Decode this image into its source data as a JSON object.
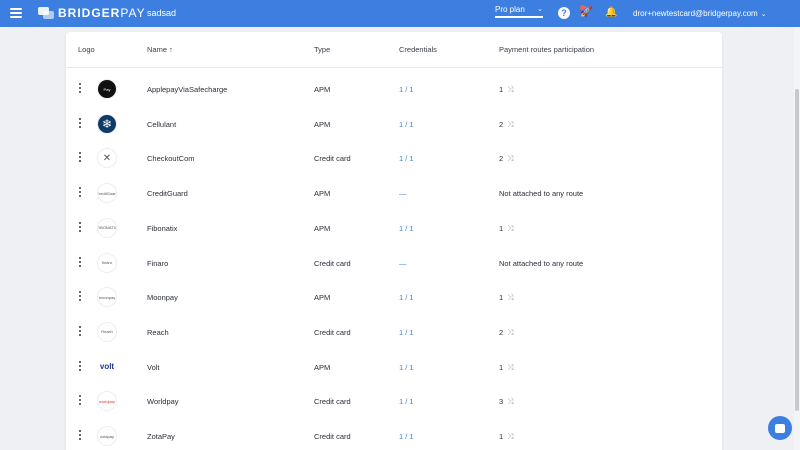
{
  "header": {
    "brand_strong": "BRIDGER",
    "brand_light": "PAY",
    "project": "sadsad",
    "plan": "Pro plan",
    "user_email": "dror+newtestcard@bridgerpay.com",
    "help_glyph": "?"
  },
  "table": {
    "columns": {
      "logo": "Logo",
      "name": "Name ↑",
      "type": "Type",
      "credentials": "Credentials",
      "routes": "Payment routes participation"
    },
    "rows": [
      {
        "logo": "Pay",
        "name": "ApplepayViaSafecharge",
        "type": "APM",
        "credentials": "1 / 1",
        "routes": "1"
      },
      {
        "logo": "❄",
        "name": "Cellulant",
        "type": "APM",
        "credentials": "1 / 1",
        "routes": "2"
      },
      {
        "logo": "✕",
        "name": "CheckoutCom",
        "type": "Credit card",
        "credentials": "1 / 1",
        "routes": "2"
      },
      {
        "logo": "CreditGuard",
        "name": "CreditGuard",
        "type": "APM",
        "credentials": "—",
        "routes": "Not attached to any route"
      },
      {
        "logo": "FIBONATIX",
        "name": "Fibonatix",
        "type": "APM",
        "credentials": "1 / 1",
        "routes": "1"
      },
      {
        "logo": "finaro",
        "name": "Finaro",
        "type": "Credit card",
        "credentials": "—",
        "routes": "Not attached to any route"
      },
      {
        "logo": "moonpay",
        "name": "Moonpay",
        "type": "APM",
        "credentials": "1 / 1",
        "routes": "1"
      },
      {
        "logo": "Reach",
        "name": "Reach",
        "type": "Credit card",
        "credentials": "1 / 1",
        "routes": "2"
      },
      {
        "logo": "volt",
        "name": "Volt",
        "type": "APM",
        "credentials": "1 / 1",
        "routes": "1"
      },
      {
        "logo": "worldpay",
        "name": "Worldpay",
        "type": "Credit card",
        "credentials": "1 / 1",
        "routes": "3"
      },
      {
        "logo": "zotapay",
        "name": "ZotaPay",
        "type": "Credit card",
        "credentials": "1 / 1",
        "routes": "1"
      }
    ]
  },
  "colors": {
    "accent": "#3d7fe0",
    "cellulant_bg": "#0d3b66",
    "apple_bg": "#111111",
    "volt_text": "#1e3a8a",
    "worldpay_text": "#e2352b"
  }
}
